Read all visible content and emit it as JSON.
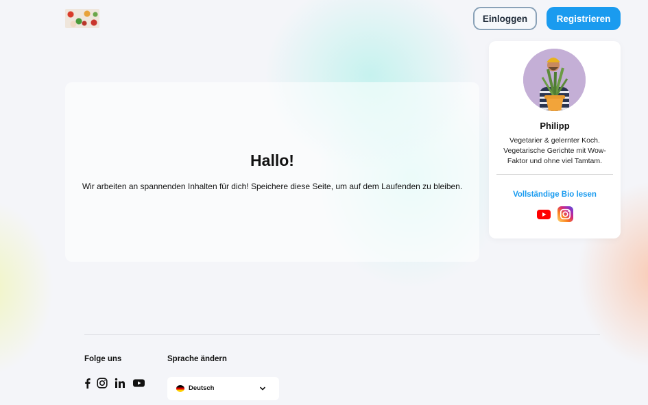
{
  "header": {
    "logo": "food-logo",
    "login_label": "Einloggen",
    "register_label": "Registrieren"
  },
  "main": {
    "title": "Hallo!",
    "text": "Wir arbeiten an spannenden Inhalten für dich! Speichere diese Seite, um auf dem Laufenden zu bleiben."
  },
  "author": {
    "name": "Philipp",
    "bio": "Vegetarier & gelernter Koch. Vegetarische Gerichte mit Wow-Faktor und ohne viel Tamtam.",
    "bio_link": "Vollständige Bio lesen",
    "social_icons": [
      "youtube-icon",
      "instagram-icon"
    ]
  },
  "footer": {
    "follow_heading": "Folge uns",
    "social_icons": [
      "facebook-icon",
      "instagram-icon",
      "linkedin-icon",
      "youtube-icon"
    ],
    "language_heading": "Sprache ändern",
    "language_selected": "Deutsch",
    "language_flag": "germany-flag-icon"
  },
  "colors": {
    "accent": "#1a9bef",
    "background": "#f4f5f9",
    "youtube": "#ff0000"
  }
}
